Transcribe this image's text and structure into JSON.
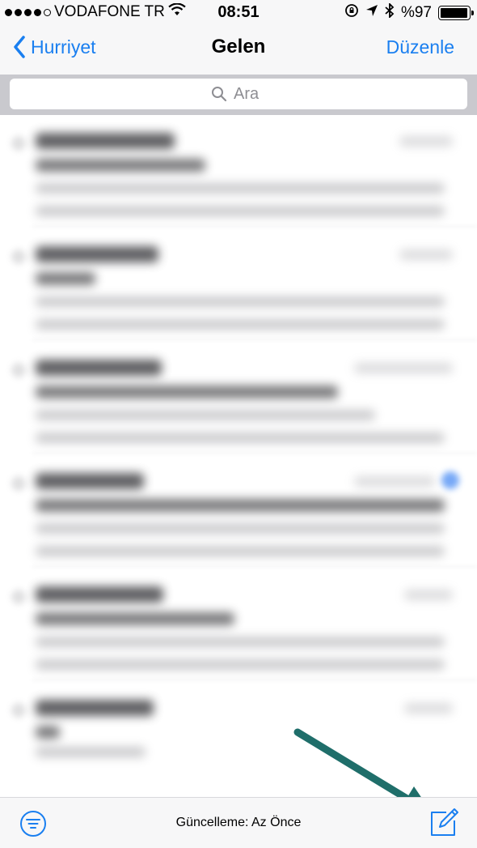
{
  "status_bar": {
    "carrier": "VODAFONE TR",
    "time": "08:51",
    "battery_percent_label": "%97",
    "battery_level": 0.97,
    "icons": [
      "signal-dots-icon",
      "wifi-icon",
      "rotation-lock-icon",
      "location-arrow-icon",
      "bluetooth-icon",
      "battery-icon"
    ]
  },
  "nav": {
    "back_label": "Hurriyet",
    "title": "Gelen",
    "edit_label": "Düzenle"
  },
  "search": {
    "placeholder": "Ara"
  },
  "toolbar": {
    "update_status": "Güncelleme: Az Önce",
    "icons": [
      "filter-icon",
      "compose-icon"
    ]
  },
  "colors": {
    "accent": "#1a7ff0",
    "bar_background": "#f7f7f8",
    "search_background": "#c9c9ce",
    "annotation_arrow": "#1f6e6a"
  }
}
